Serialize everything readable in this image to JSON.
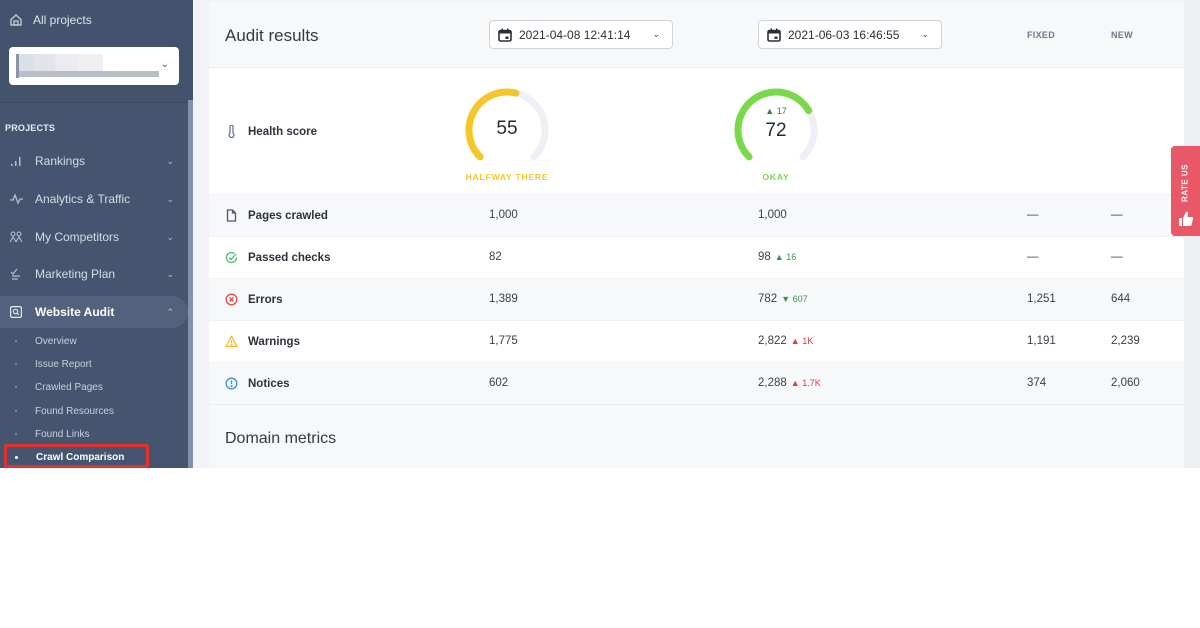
{
  "sidebar": {
    "all_projects_label": "All projects",
    "section_label": "PROJECTS",
    "nav_items": [
      {
        "label": "Rankings",
        "icon": "bar-chart-icon"
      },
      {
        "label": "Analytics & Traffic",
        "icon": "pulse-icon"
      },
      {
        "label": "My Competitors",
        "icon": "competitors-icon"
      },
      {
        "label": "Marketing Plan",
        "icon": "checklist-icon"
      },
      {
        "label": "Website Audit",
        "icon": "audit-icon",
        "expanded": true
      }
    ],
    "sub_items": [
      {
        "label": "Overview"
      },
      {
        "label": "Issue Report"
      },
      {
        "label": "Crawled Pages"
      },
      {
        "label": "Found Resources"
      },
      {
        "label": "Found Links"
      },
      {
        "label": "Crawl Comparison",
        "active": true
      }
    ]
  },
  "audit": {
    "title": "Audit results",
    "date_a": "2021-04-08 12:41:14",
    "date_b": "2021-06-03 16:46:55",
    "col_fixed": "FIXED",
    "col_new": "NEW",
    "health": {
      "label": "Health score",
      "score_a": 55,
      "score_b": 72,
      "max": 100,
      "status_a": "HALFWAY THERE",
      "status_b": "OKAY",
      "delta_b": "17",
      "color_a": "#f5c629",
      "color_b": "#79d94a",
      "track_color": "#eef0f5"
    },
    "rows": [
      {
        "label": "Pages crawled",
        "icon": "page-icon",
        "value_a": "1,000",
        "value_b": "1,000",
        "delta": "",
        "fixed": "—",
        "new": "—"
      },
      {
        "label": "Passed checks",
        "icon": "check-circle-icon",
        "value_a": "82",
        "value_b": "98",
        "delta": "16",
        "delta_dir": "up",
        "delta_color": "#3d8f4d",
        "fixed": "—",
        "new": "—"
      },
      {
        "label": "Errors",
        "icon": "error-circle-icon",
        "value_a": "1,389",
        "value_b": "782",
        "delta": "607",
        "delta_dir": "down",
        "delta_color": "#3d8f4d",
        "fixed": "1,251",
        "new": "644"
      },
      {
        "label": "Warnings",
        "icon": "warning-triangle-icon",
        "value_a": "1,775",
        "value_b": "2,822",
        "delta": "1K",
        "delta_dir": "up",
        "delta_color": "#e0383e",
        "fixed": "1,191",
        "new": "2,239"
      },
      {
        "label": "Notices",
        "icon": "info-circle-icon",
        "value_a": "602",
        "value_b": "2,288",
        "delta": "1.7K",
        "delta_dir": "up",
        "delta_color": "#e0383e",
        "fixed": "374",
        "new": "2,060"
      }
    ],
    "domain_metrics_title": "Domain metrics"
  },
  "rate_us": {
    "label": "RATE US"
  },
  "colors": {
    "sidebar_bg": "#455570",
    "highlight": "#e0332d",
    "rate_us": "#e95866"
  }
}
